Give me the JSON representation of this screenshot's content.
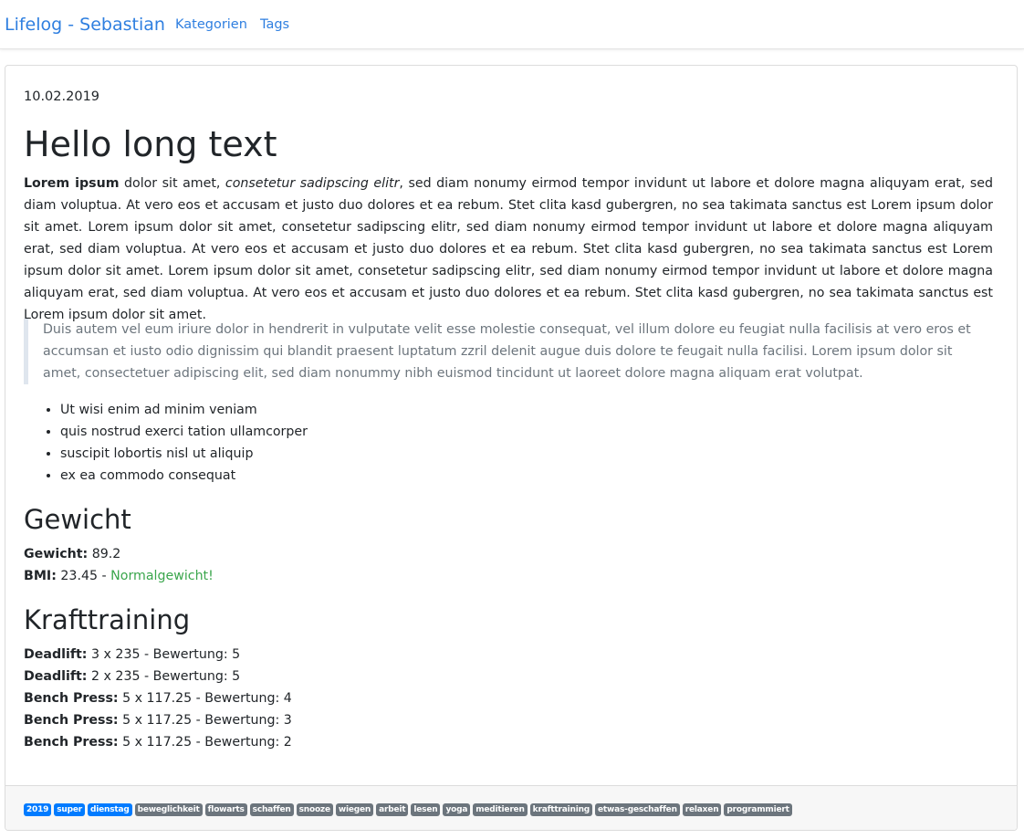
{
  "navbar": {
    "brand": "Lifelog - Sebastian",
    "links": [
      "Kategorien",
      "Tags"
    ]
  },
  "entry": {
    "date": "10.02.2019",
    "title": "Hello long text",
    "para_bold": "Lorem ipsum",
    "para_mid": " dolor sit amet, ",
    "para_italic": "consetetur sadipscing elitr",
    "para_rest": ", sed diam nonumy eirmod tempor invidunt ut labore et dolore magna aliquyam erat, sed diam voluptua. At vero eos et accusam et justo duo dolores et ea rebum. Stet clita kasd gubergren, no sea takimata sanctus est Lorem ipsum dolor sit amet. Lorem ipsum dolor sit amet, consetetur sadipscing elitr, sed diam nonumy eirmod tempor invidunt ut labore et dolore magna aliquyam erat, sed diam voluptua. At vero eos et accusam et justo duo dolores et ea rebum. Stet clita kasd gubergren, no sea takimata sanctus est Lorem ipsum dolor sit amet. Lorem ipsum dolor sit amet, consetetur sadipscing elitr, sed diam nonumy eirmod tempor invidunt ut labore et dolore magna aliquyam erat, sed diam voluptua. At vero eos et accusam et justo duo dolores et ea rebum. Stet clita kasd gubergren, no sea takimata sanctus est Lorem ipsum dolor sit amet.",
    "quote": "Duis autem vel eum iriure dolor in hendrerit in vulputate velit esse molestie consequat, vel illum dolore eu feugiat nulla facilisis at vero eros et accumsan et iusto odio dignissim qui blandit praesent luptatum zzril delenit augue duis dolore te feugait nulla facilisi. Lorem ipsum dolor sit amet, consectetuer adipiscing elit, sed diam nonummy nibh euismod tincidunt ut laoreet dolore magna aliquam erat volutpat.",
    "list": [
      "Ut wisi enim ad minim veniam",
      "quis nostrud exerci tation ullamcorper",
      "suscipit lobortis nisl ut aliquip",
      "ex ea commodo consequat"
    ]
  },
  "weight": {
    "heading": "Gewicht",
    "weight_label": "Gewicht:",
    "weight_value": " 89.2",
    "bmi_label": "BMI:",
    "bmi_value": " 23.45 - ",
    "bmi_status": "Normalgewicht!",
    "status_color": "#3aa64c"
  },
  "strength": {
    "heading": "Krafttraining",
    "sets": [
      {
        "label": "Deadlift:",
        "detail": " 3 x 235 - Bewertung: 5"
      },
      {
        "label": "Deadlift:",
        "detail": " 2 x 235 - Bewertung: 5"
      },
      {
        "label": "Bench Press:",
        "detail": " 5 x 117.25 - Bewertung: 4"
      },
      {
        "label": "Bench Press:",
        "detail": " 5 x 117.25 - Bewertung: 3"
      },
      {
        "label": "Bench Press:",
        "detail": " 5 x 117.25 - Bewertung: 2"
      }
    ]
  },
  "tags": {
    "primary": [
      "2019",
      "super",
      "dienstag"
    ],
    "secondary": [
      "beweglichkeit",
      "flowarts",
      "schaffen",
      "snooze",
      "wiegen",
      "arbeit",
      "lesen",
      "yoga",
      "meditieren",
      "krafttraining",
      "etwas-geschaffen",
      "relaxen",
      "programmiert"
    ],
    "primary_color": "#007bff",
    "secondary_color": "#6c757d"
  },
  "colors": {
    "link": "#2f7fe0",
    "text": "#212529",
    "muted": "#6c757d"
  }
}
